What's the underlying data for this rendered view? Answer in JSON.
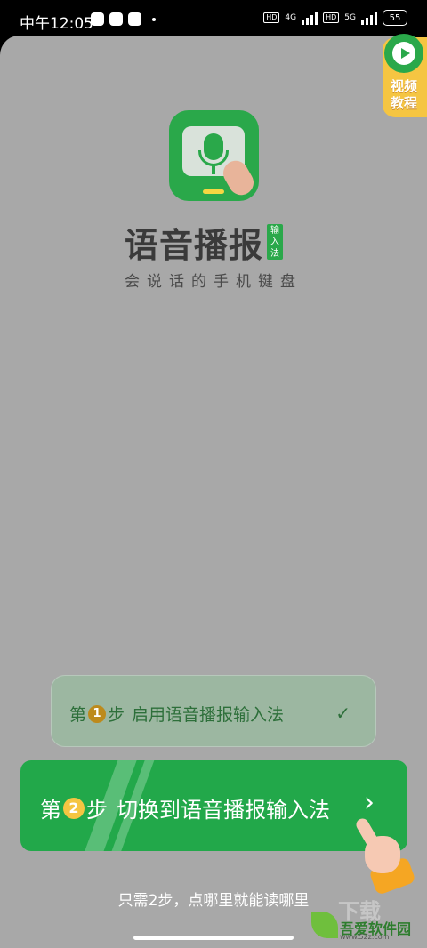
{
  "statusbar": {
    "time": "中午12:05",
    "net1": "4G",
    "net2": "5G",
    "hd": "HD",
    "battery": "55"
  },
  "video_tutorial": {
    "label_line1": "视频",
    "label_line2": "教程"
  },
  "app": {
    "name": "语音播报",
    "tag": "输入法",
    "slogan": "会说话的手机键盘"
  },
  "steps": [
    {
      "prefix": "第",
      "num": "1",
      "suffix": "步",
      "text": "启用语音播报输入法",
      "done": true
    },
    {
      "prefix": "第",
      "num": "2",
      "suffix": "步",
      "text": "切换到语音播报输入法",
      "done": false
    }
  ],
  "hint": "只需2步，点哪里就能读哪里",
  "watermark": {
    "title": "吾爱软件园",
    "url": "www.52z.com",
    "overlay": "下载"
  },
  "colors": {
    "primary": "#22a84a",
    "overlay": "#a8a8a8",
    "accent": "#f5c542"
  }
}
